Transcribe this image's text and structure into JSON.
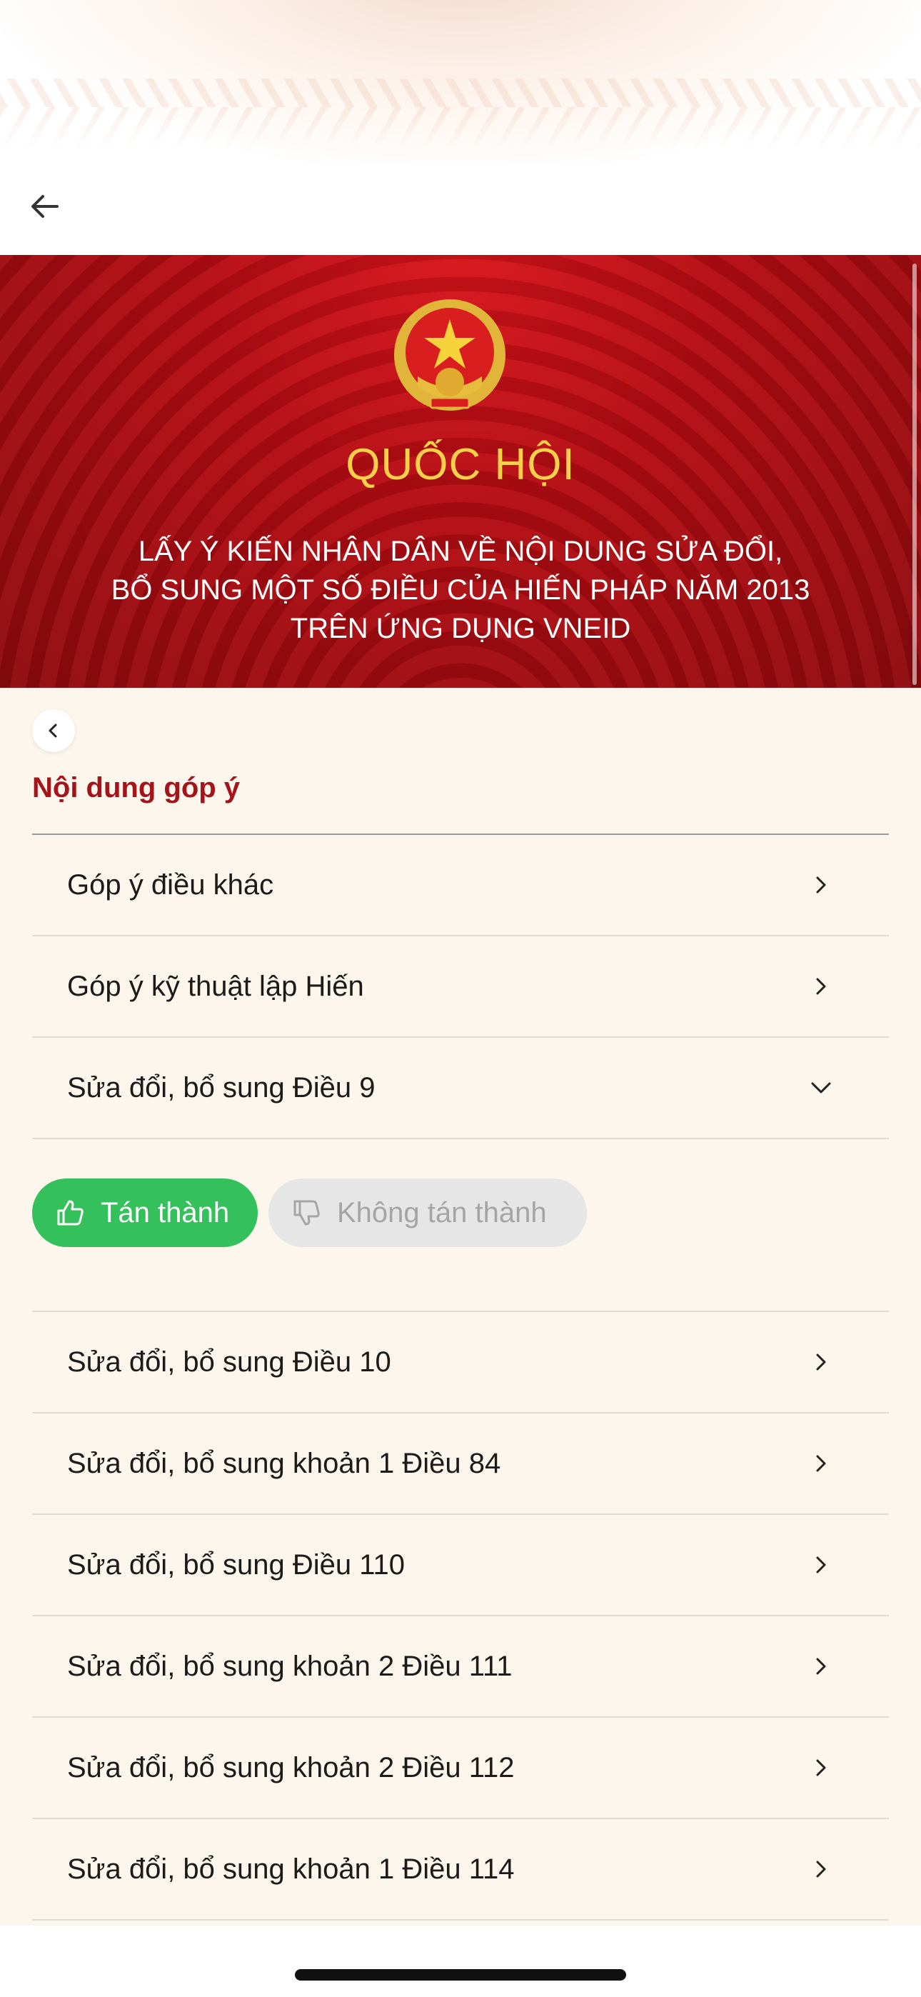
{
  "header": {
    "back_icon": "arrow-left-icon"
  },
  "banner": {
    "emblem": "vietnam-national-emblem",
    "title": "QUỐC HỘI",
    "subtitle_lines": [
      "LẤY Ý KIẾN NHÂN DÂN VỀ NỘI DUNG SỬA ĐỔI,",
      "BỔ SUNG MỘT SỐ ĐIỀU CỦA HIẾN PHÁP NĂM 2013",
      "TRÊN ỨNG DỤNG VNEID"
    ],
    "colors": {
      "background": "#b50c12",
      "title": "#f8d04a",
      "subtitle": "#ffffff"
    }
  },
  "content": {
    "back_icon": "chevron-left-icon",
    "section_title": "Nội dung góp ý",
    "items_before": [
      {
        "label": "Góp ý điều khác",
        "icon": "chevron-right-icon"
      },
      {
        "label": "Góp ý kỹ thuật lập Hiến",
        "icon": "chevron-right-icon"
      },
      {
        "label": "Sửa đổi, bổ sung Điều 9",
        "icon": "chevron-down-icon",
        "expanded": true
      }
    ],
    "vote": {
      "approve_label": "Tán thành",
      "approve_icon": "thumbs-up-icon",
      "approve_selected": true,
      "disapprove_label": "Không tán thành",
      "disapprove_icon": "thumbs-down-icon"
    },
    "items_after": [
      {
        "label": "Sửa đổi, bổ sung Điều 10",
        "icon": "chevron-right-icon"
      },
      {
        "label": "Sửa đổi, bổ sung khoản 1 Điều 84",
        "icon": "chevron-right-icon"
      },
      {
        "label": "Sửa đổi, bổ sung Điều 110",
        "icon": "chevron-right-icon"
      },
      {
        "label": "Sửa đổi, bổ sung khoản 2 Điều 111",
        "icon": "chevron-right-icon"
      },
      {
        "label": "Sửa đổi, bổ sung khoản 2 Điều 112",
        "icon": "chevron-right-icon"
      },
      {
        "label": "Sửa đổi, bổ sung khoản 1 Điều 114",
        "icon": "chevron-right-icon"
      }
    ],
    "colors": {
      "accent": "#a3151b",
      "approve": "#34c05a",
      "disapprove_bg": "#e6e6e6",
      "background": "#fcf6ec"
    }
  }
}
